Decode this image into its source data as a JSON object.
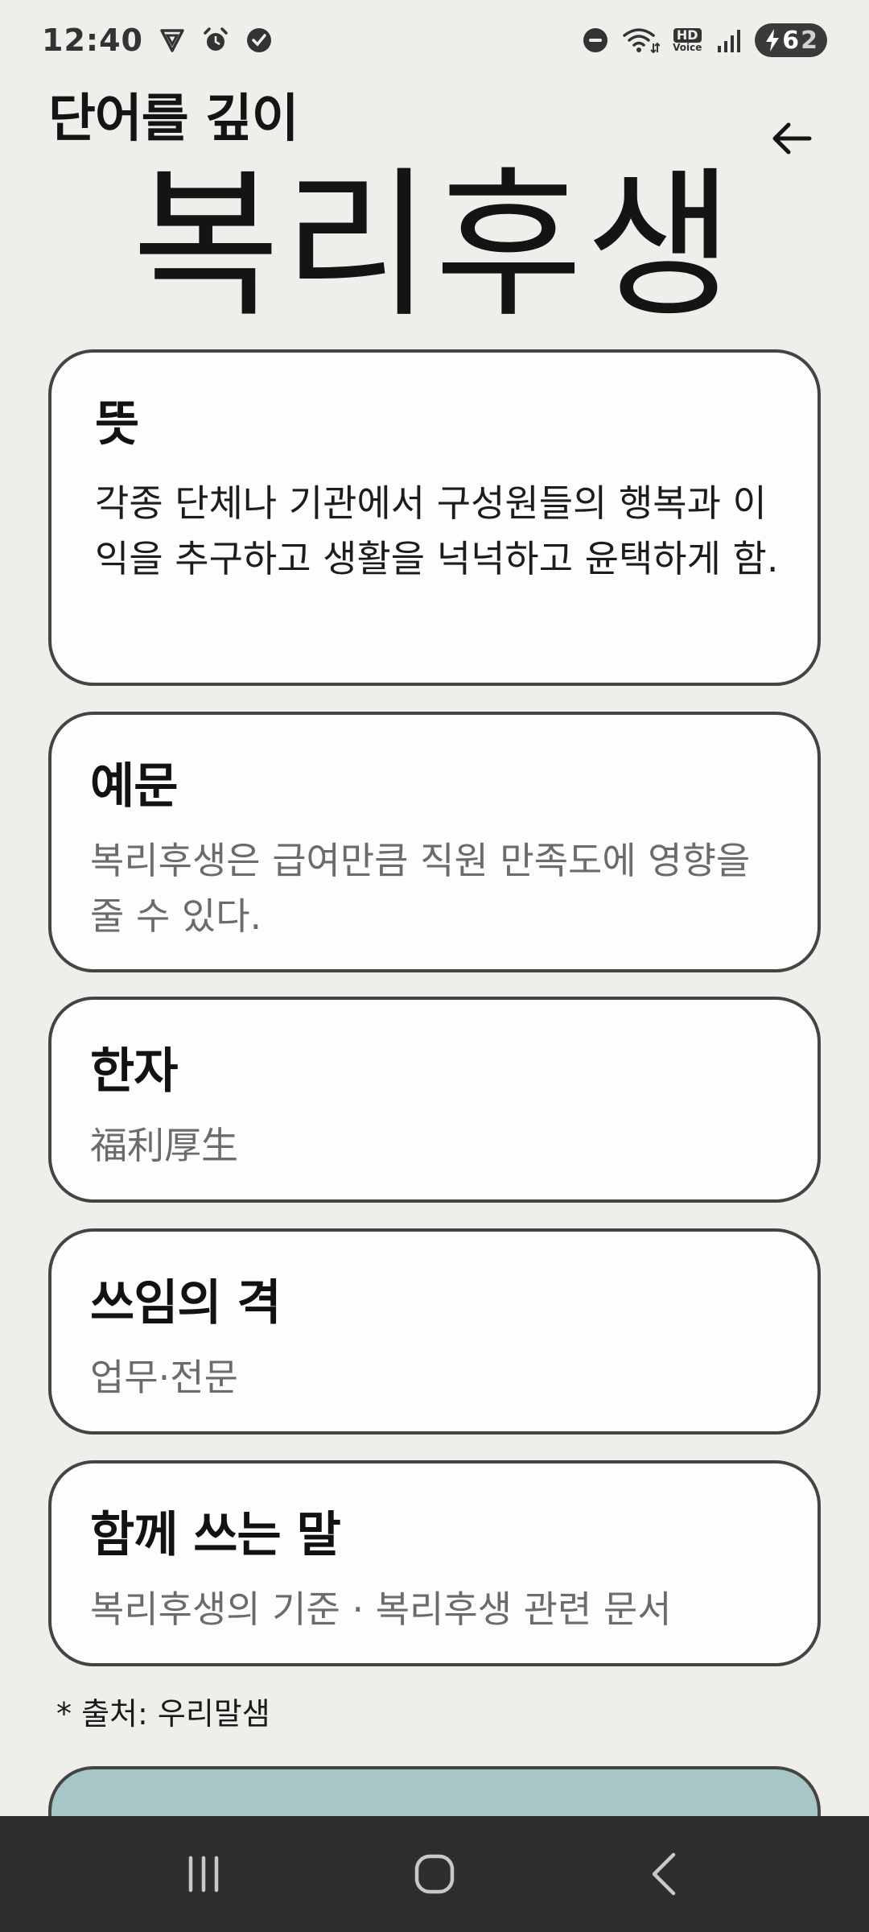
{
  "status_bar": {
    "time": "12:40",
    "battery_level": "62",
    "battery_level_first": "6",
    "battery_level_second": "2",
    "hd_voice_label": "HD",
    "hd_voice_sub": "Voice",
    "icons": [
      "vpn-icon",
      "alarm-icon",
      "check-circle-icon",
      "do-not-disturb-icon",
      "wifi-icon",
      "hd-voice-icon",
      "signal-icon",
      "battery-charging-icon"
    ]
  },
  "header": {
    "title": "단어를 깊이",
    "headword": "복리후생"
  },
  "cards": {
    "meaning": {
      "title": "뜻",
      "body": "각종 단체나 기관에서 구성원들의 행복과 이익을 추구하고 생활을 넉넉하고 윤택하게 함."
    },
    "example": {
      "title": "예문",
      "body": "복리후생은 급여만큼 직원 만족도에 영향을 줄 수 있다."
    },
    "hanja": {
      "title": "한자",
      "body": "福利厚生"
    },
    "register": {
      "title": "쓰임의 격",
      "body": "업무·전문"
    },
    "collocation": {
      "title": "함께 쓰는 말",
      "body": "복리후생의 기준 · 복리후생 관련 문서"
    }
  },
  "source_note": "* 출처: 우리말샘",
  "colors": {
    "background": "#f0eeea",
    "card": "#fdfdfc",
    "card_border": "#444444",
    "bottom_card": "#a9c6c7",
    "nav_bar": "#2e2e2e"
  }
}
